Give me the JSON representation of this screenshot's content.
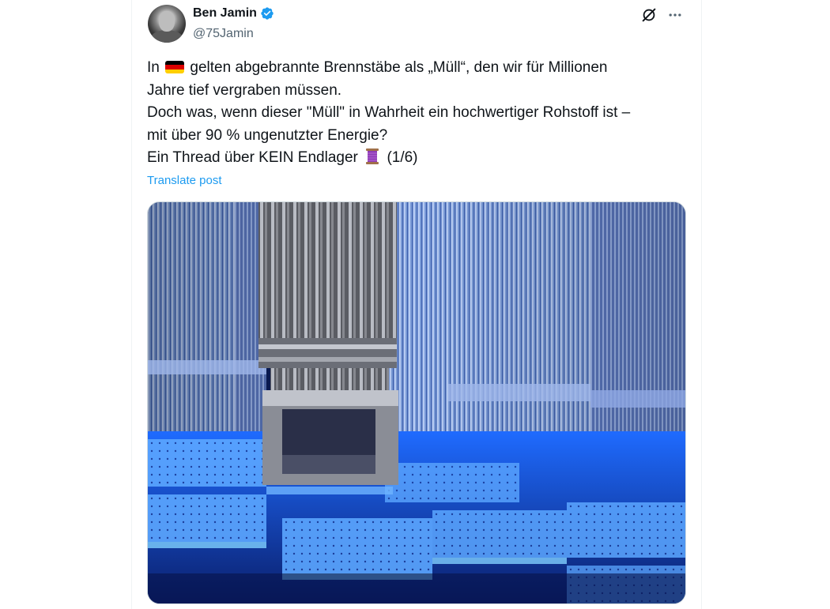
{
  "author": {
    "display_name": "Ben Jamin",
    "handle": "@75Jamin",
    "verified": true,
    "avatar": "avatar-bust-photo"
  },
  "header_icons": {
    "grok": "grok-icon",
    "more": "more-dots-icon"
  },
  "tweet": {
    "line1_a": "In",
    "line1_flag": "germany-flag-emoji",
    "line1_b": "gelten abgebrannte Brennstäbe als „Müll“, den wir für Millionen",
    "line2": "Jahre tief vergraben müssen.",
    "line3": "Doch was, wenn dieser \"Müll\" in Wahrheit ein hochwertiger Rohstoff ist –",
    "line4": "mit über 90 % ungenutzter Energie?",
    "line5_a": "Ein Thread über KEIN Endlager",
    "line5_emoji": "thread-spool-emoji",
    "line5_b": "(1/6)"
  },
  "translate_label": "Translate post",
  "media": {
    "kind": "photo",
    "subject": "fuel-assembly-rack-blue-glow"
  },
  "colors": {
    "link_blue": "#1d9bf0",
    "text_primary": "#0f1419",
    "text_secondary": "#536471",
    "glow_blue": "#2f7dff"
  }
}
